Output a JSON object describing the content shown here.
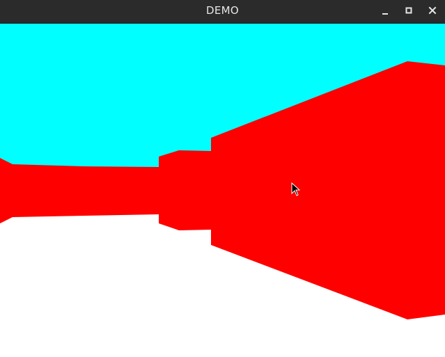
{
  "window": {
    "title": "DEMO",
    "controls": {
      "minimize_icon": "minimize-icon",
      "maximize_icon": "maximize-icon",
      "close_icon": "close-icon"
    }
  },
  "scene": {
    "type": "raycaster-3d-view",
    "colors": {
      "sky": "#00ffff",
      "floor": "#ffffff",
      "wall": "#ff0000",
      "titlebar": "#2b2b2b",
      "title_text": "#e6e6e6"
    },
    "cursor_icon": "arrow-cursor-icon"
  }
}
